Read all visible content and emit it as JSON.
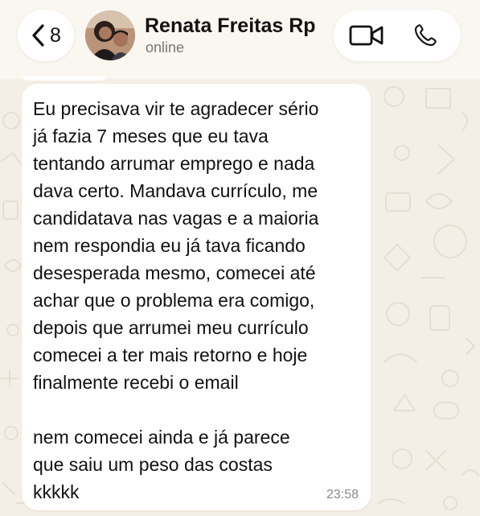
{
  "header": {
    "back_count": "8",
    "contact_name": "Renata Freitas Rp",
    "status": "online"
  },
  "message": {
    "text": "Eu precisava vir te agradecer sério\njá fazia 7 meses que eu tava\ntentando arrumar emprego e nada\ndava certo. Mandava currículo, me\ncandidatava nas vagas e a maioria\nnem respondia eu já tava ficando\ndesesperada mesmo, comecei até\nachar que o problema era comigo,\ndepois que arrumei meu currículo\ncomecei a ter mais retorno e hoje\nfinalmente recebi o email\n\nnem comecei ainda e já parece\nque saiu um peso das costas\nkkkkk",
    "time": "23:58"
  },
  "icons": {
    "back": "chevron-left-icon",
    "video": "video-camera-icon",
    "call": "phone-icon"
  },
  "colors": {
    "wallpaper": "#f4efe6",
    "bubble": "#ffffff",
    "text": "#111111",
    "timestamp": "#8a8a8a"
  }
}
